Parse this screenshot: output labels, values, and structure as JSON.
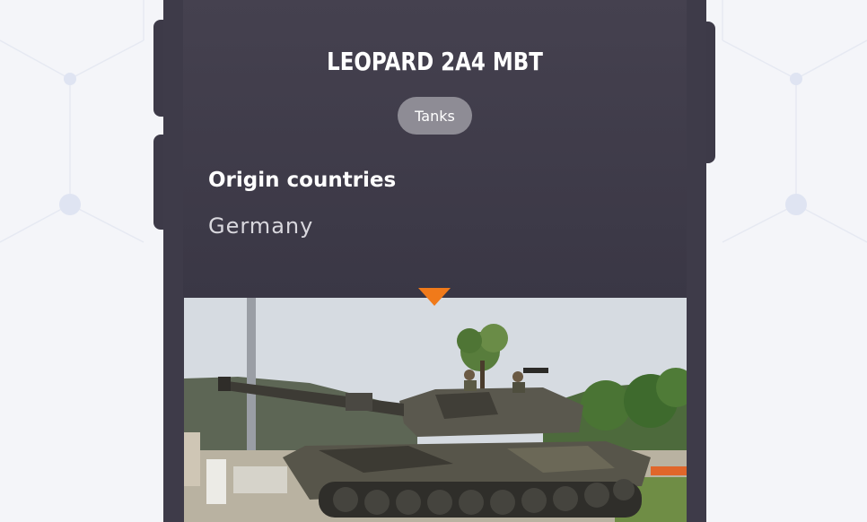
{
  "vehicle": {
    "title": "LEOPARD 2A4 MBT",
    "category_badge": "Tanks",
    "origin_label": "Origin countries",
    "origin_value": "Germany"
  },
  "icons": {
    "pointer": "triangle-down-icon"
  },
  "colors": {
    "card_background": "#3e3b49",
    "badge_background": "#8e8c95",
    "accent": "#f07a1a",
    "page_background": "#f4f5f9"
  }
}
